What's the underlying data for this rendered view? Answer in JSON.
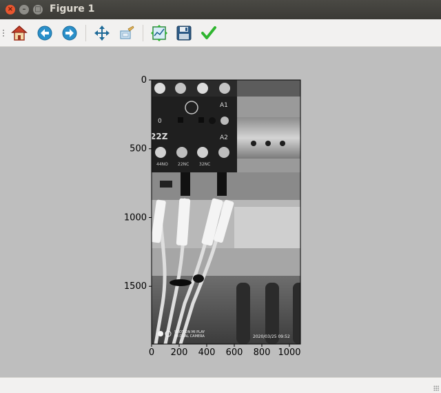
{
  "window": {
    "title": "Figure 1"
  },
  "toolbar": {
    "buttons": [
      {
        "name": "home-button",
        "icon": "home-icon"
      },
      {
        "name": "back-button",
        "icon": "back-arrow-icon"
      },
      {
        "name": "forward-button",
        "icon": "forward-arrow-icon"
      },
      {
        "name": "pan-button",
        "icon": "move-icon"
      },
      {
        "name": "zoom-button",
        "icon": "zoom-rect-icon"
      },
      {
        "name": "subplots-button",
        "icon": "subplots-icon"
      },
      {
        "name": "save-button",
        "icon": "floppy-icon"
      },
      {
        "name": "edit-button",
        "icon": "checkmark-icon"
      }
    ]
  },
  "axes": {
    "xticks": [
      "0",
      "200",
      "400",
      "600",
      "800",
      "1000"
    ],
    "yticks": [
      "0",
      "500",
      "1000",
      "1500"
    ]
  },
  "photo": {
    "labels": [
      "A1",
      "A2",
      "0",
      "22Z",
      "44NO",
      "22NC",
      "32NC"
    ],
    "watermark": [
      "SHOT ON MI PLAY",
      "MI DUAL CAMERA"
    ],
    "timestamp": "2020/03/25 09:52"
  },
  "colors": {
    "accent_green": "#2fb52f",
    "toolbar_bg": "#f2f1f0",
    "canvas_bg": "#bebebe"
  }
}
